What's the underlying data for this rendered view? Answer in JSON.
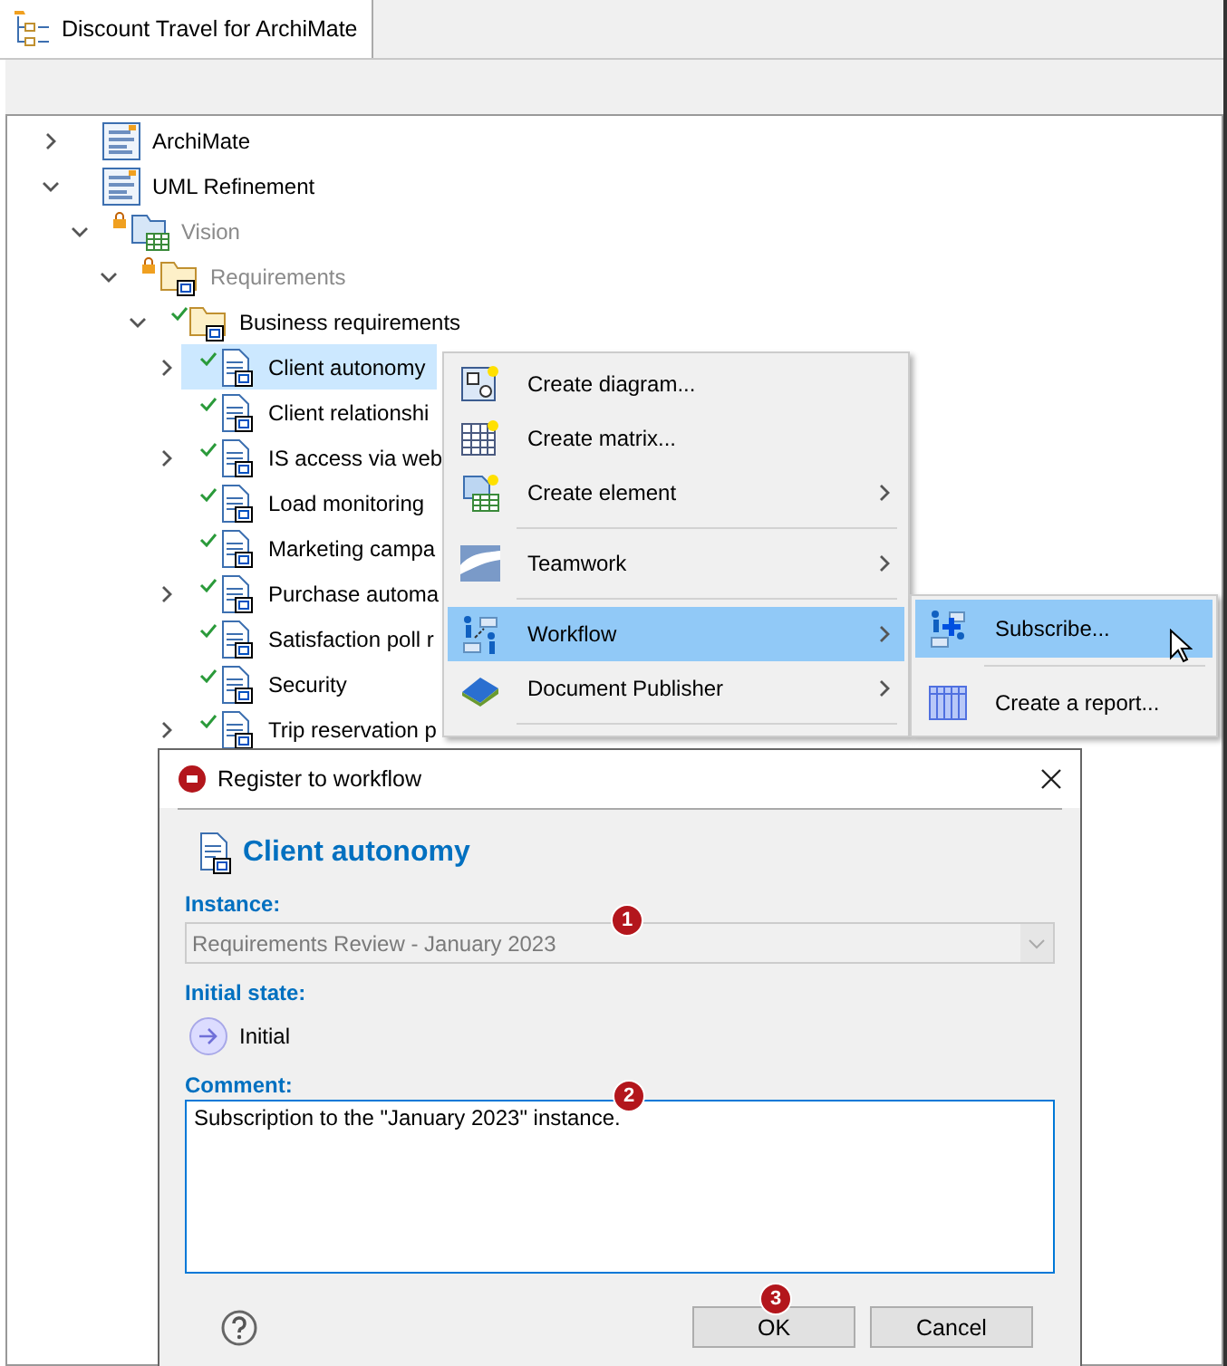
{
  "window": {
    "tab_title": "Discount Travel for ArchiMate"
  },
  "tree": {
    "items": [
      {
        "label": "ArchiMate",
        "kind": "model",
        "expandable": true,
        "expanded": false,
        "locked": false,
        "checked": false,
        "dimmed": false,
        "selected": false
      },
      {
        "label": "UML Refinement",
        "kind": "model",
        "expandable": true,
        "expanded": true,
        "locked": false,
        "checked": false,
        "dimmed": false,
        "selected": false,
        "children": [
          {
            "label": "Vision",
            "kind": "package",
            "expandable": true,
            "expanded": true,
            "locked": true,
            "checked": false,
            "dimmed": true,
            "selected": false,
            "children": [
              {
                "label": "Requirements",
                "kind": "folder",
                "expandable": true,
                "expanded": true,
                "locked": true,
                "checked": false,
                "dimmed": true,
                "selected": false,
                "children": [
                  {
                    "label": "Business requirements",
                    "kind": "folder",
                    "expandable": true,
                    "expanded": true,
                    "locked": false,
                    "checked": true,
                    "dimmed": false,
                    "selected": false,
                    "children": [
                      {
                        "label": "Client autonomy",
                        "kind": "requirement",
                        "expandable": true,
                        "expanded": false,
                        "locked": false,
                        "checked": true,
                        "dimmed": false,
                        "selected": true
                      },
                      {
                        "label": "Client relationshi",
                        "kind": "requirement",
                        "expandable": false,
                        "locked": false,
                        "checked": true,
                        "dimmed": false,
                        "selected": false
                      },
                      {
                        "label": "IS access via web",
                        "kind": "requirement",
                        "expandable": true,
                        "expanded": false,
                        "locked": false,
                        "checked": true,
                        "dimmed": false,
                        "selected": false
                      },
                      {
                        "label": "Load monitoring",
                        "kind": "requirement",
                        "expandable": false,
                        "locked": false,
                        "checked": true,
                        "dimmed": false,
                        "selected": false
                      },
                      {
                        "label": "Marketing campa",
                        "kind": "requirement",
                        "expandable": false,
                        "locked": false,
                        "checked": true,
                        "dimmed": false,
                        "selected": false
                      },
                      {
                        "label": "Purchase automa",
                        "kind": "requirement",
                        "expandable": true,
                        "expanded": false,
                        "locked": false,
                        "checked": true,
                        "dimmed": false,
                        "selected": false
                      },
                      {
                        "label": "Satisfaction poll r",
                        "kind": "requirement",
                        "expandable": false,
                        "locked": false,
                        "checked": true,
                        "dimmed": false,
                        "selected": false
                      },
                      {
                        "label": "Security",
                        "kind": "requirement",
                        "expandable": false,
                        "locked": false,
                        "checked": true,
                        "dimmed": false,
                        "selected": false
                      },
                      {
                        "label": "Trip reservation p",
                        "kind": "requirement",
                        "expandable": true,
                        "expanded": false,
                        "locked": false,
                        "checked": true,
                        "dimmed": false,
                        "selected": false
                      }
                    ]
                  }
                ]
              }
            ]
          }
        ]
      }
    ]
  },
  "context_menu": {
    "items": [
      {
        "kind": "item",
        "label": "Create diagram...",
        "submenu": false,
        "selected": false
      },
      {
        "kind": "item",
        "label": "Create matrix...",
        "submenu": false,
        "selected": false
      },
      {
        "kind": "item",
        "label": "Create element",
        "submenu": true,
        "selected": false
      },
      {
        "kind": "separator"
      },
      {
        "kind": "item",
        "label": "Teamwork",
        "submenu": true,
        "selected": false
      },
      {
        "kind": "separator"
      },
      {
        "kind": "item",
        "label": "Workflow",
        "submenu": true,
        "selected": true
      },
      {
        "kind": "item",
        "label": "Document Publisher",
        "submenu": true,
        "selected": false
      },
      {
        "kind": "separator"
      }
    ]
  },
  "submenu": {
    "items": [
      {
        "kind": "item",
        "label": "Subscribe...",
        "submenu": false,
        "selected": true
      },
      {
        "kind": "separator"
      },
      {
        "kind": "item",
        "label": "Create a report...",
        "submenu": false,
        "selected": false
      }
    ]
  },
  "dialog": {
    "title": "Register to workflow",
    "heading": "Client autonomy",
    "instance": {
      "label": "Instance:",
      "value": "Requirements Review - January 2023",
      "disabled": true,
      "callout": "1"
    },
    "initial_state": {
      "label": "Initial state:",
      "value": "Initial"
    },
    "comment": {
      "label": "Comment:",
      "value": "Subscription to the \"January 2023\" instance.",
      "callout": "2"
    },
    "buttons": [
      {
        "label": "OK",
        "callout": "3"
      },
      {
        "label": "Cancel"
      }
    ]
  }
}
